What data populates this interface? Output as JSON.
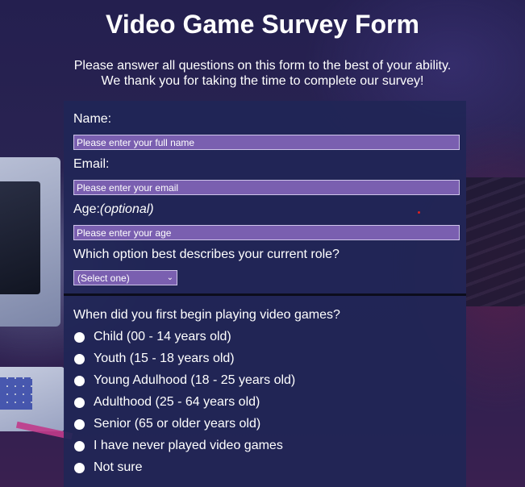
{
  "header": {
    "title": "Video Game Survey Form",
    "description_line1": "Please answer all questions on this form to the best of your ability.",
    "description_line2": "We thank you for taking the time to complete our survey!"
  },
  "form": {
    "name_label": "Name:",
    "name_placeholder": "Please enter your full name",
    "email_label": "Email:",
    "email_placeholder": "Please enter your email",
    "age_label": "Age:",
    "age_optional": "(optional)",
    "age_placeholder": "Please enter your age",
    "role_question": "Which option best describes your current role?",
    "role_selected": "(Select one)",
    "first_play_question": "When did you first begin playing video games?",
    "first_play_options": [
      "Child (00 - 14 years old)",
      "Youth (15 - 18 years old)",
      "Young Adulhood (18 - 25 years old)",
      "Adulthood (25 - 64 years old)",
      "Senior (65 or older years old)",
      "I have never played video games",
      "Not sure"
    ]
  },
  "colors": {
    "input_bg": "#7a5fb0",
    "form_bg": "#202656",
    "accent_dot": "#e02020"
  }
}
